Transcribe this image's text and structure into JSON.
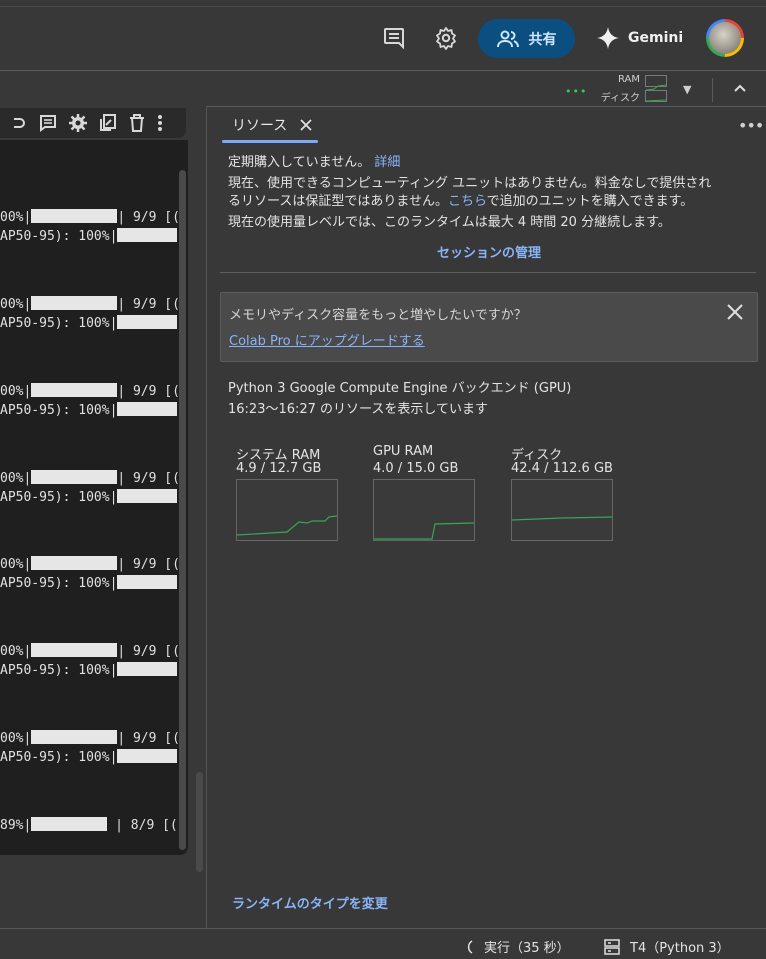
{
  "header": {
    "share_label": "共有",
    "gemini_label": "Gemini"
  },
  "resource_indicator": {
    "ram_label": "RAM",
    "disk_label": "ディスク",
    "status_dots": "•••"
  },
  "output": {
    "lines": [
      {
        "a": "00%|",
        "b": "| 9/9 [(",
        "c": "AP50-95): 100%|"
      },
      {
        "a": "00%|",
        "b": "| 9/9 [(",
        "c": "AP50-95): 100%|"
      },
      {
        "a": "00%|",
        "b": "| 9/9 [(",
        "c": "AP50-95): 100%|"
      },
      {
        "a": "00%|",
        "b": "| 9/9 [(",
        "c": "AP50-95): 100%|"
      },
      {
        "a": "00%|",
        "b": "| 9/9 [(",
        "c": "AP50-95): 100%|"
      },
      {
        "a": "00%|",
        "b": "| 9/9 [(",
        "c": "AP50-95): 100%|"
      },
      {
        "a": "00%|",
        "b": "| 9/9 [(",
        "c": "AP50-95): 100%|"
      },
      {
        "a": "89%|",
        "b": " | 8/9 [(",
        "c": ""
      }
    ]
  },
  "resources": {
    "tab_label": "リソース",
    "subscription_text": "定期購入していません。",
    "details_link": "詳細",
    "units_line1": "現在、使用できるコンピューティング ユニットはありません。料金なしで提供され",
    "units_line2a": "るリソースは保証型ではありません。",
    "units_link": "こちら",
    "units_line2b": "で追加のユニットを購入できます。",
    "usage_line": "現在の使用量レベルでは、このランタイムは最大 4 時間 20 分継続します。",
    "manage_sessions": "セッションの管理",
    "upgrade_question": "メモリやディスク容量をもっと増やしたいですか？",
    "upgrade_link": "Colab Pro にアップグレードする",
    "backend": "Python 3 Google Compute Engine バックエンド (GPU)",
    "time_range": "16:23〜16:27 のリソースを表示しています",
    "graphs": [
      {
        "title": "システム RAM",
        "value": "4.9 / 12.7 GB"
      },
      {
        "title": "GPU RAM",
        "value": "4.0 / 15.0 GB"
      },
      {
        "title": "ディスク",
        "value": "42.4 / 112.6 GB"
      }
    ],
    "change_runtime": "ランタイムのタイプを変更"
  },
  "status": {
    "run_label": "実行（35 秒）",
    "runtime_label": "T4（Python 3）"
  },
  "colors": {
    "accent": "#8ab4f8",
    "graph_line": "#34a853",
    "share_bg": "#0b4e80"
  }
}
